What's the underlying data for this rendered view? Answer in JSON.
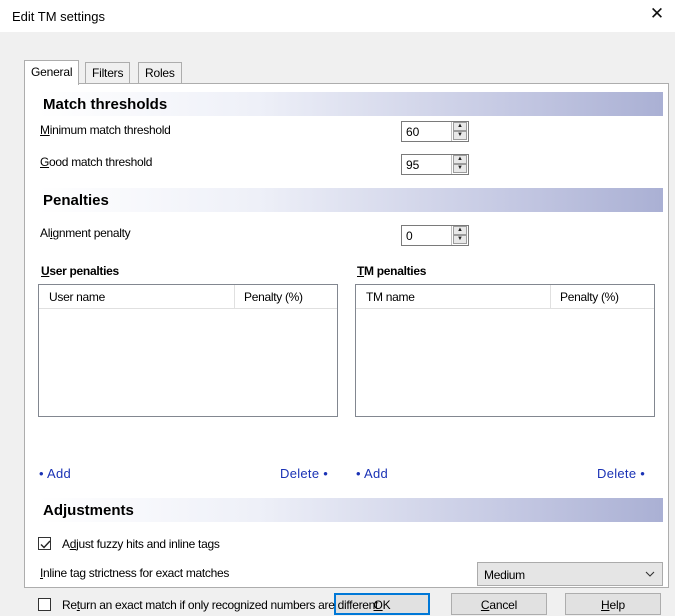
{
  "window": {
    "title": "Edit TM settings"
  },
  "tabs": [
    {
      "label": "General"
    },
    {
      "label": "Filters"
    },
    {
      "label": "Roles"
    }
  ],
  "match_thresholds": {
    "heading": "Match thresholds",
    "minimum_label": "Minimum match threshold",
    "minimum_value": "60",
    "good_label": "Good match threshold",
    "good_value": "95"
  },
  "penalties": {
    "heading": "Penalties",
    "alignment_label": "Alignment penalty",
    "alignment_value": "0",
    "user_penalties": {
      "heading": "User penalties",
      "columns": [
        "User name",
        "Penalty (%)"
      ],
      "rows": [],
      "add_label": "• Add",
      "delete_label": "Delete •"
    },
    "tm_penalties": {
      "heading": "TM penalties",
      "columns": [
        "TM name",
        "Penalty (%)"
      ],
      "rows": [],
      "add_label": "• Add",
      "delete_label": "Delete •"
    }
  },
  "adjustments": {
    "heading": "Adjustments",
    "fuzzy_checkbox_label": "Adjust fuzzy hits and inline tags",
    "fuzzy_checked": true,
    "strictness_label": "Inline tag strictness for exact matches",
    "strictness_value": "Medium",
    "numbers_checkbox_label": "Return an exact match if only recognized numbers are different",
    "numbers_checked": false
  },
  "buttons": {
    "ok": "OK",
    "cancel": "Cancel",
    "help": "Help"
  },
  "colors": {
    "link": "#1a32b5",
    "section_gradient_end": "#aab0d4",
    "default_button_border": "#0078d7"
  }
}
